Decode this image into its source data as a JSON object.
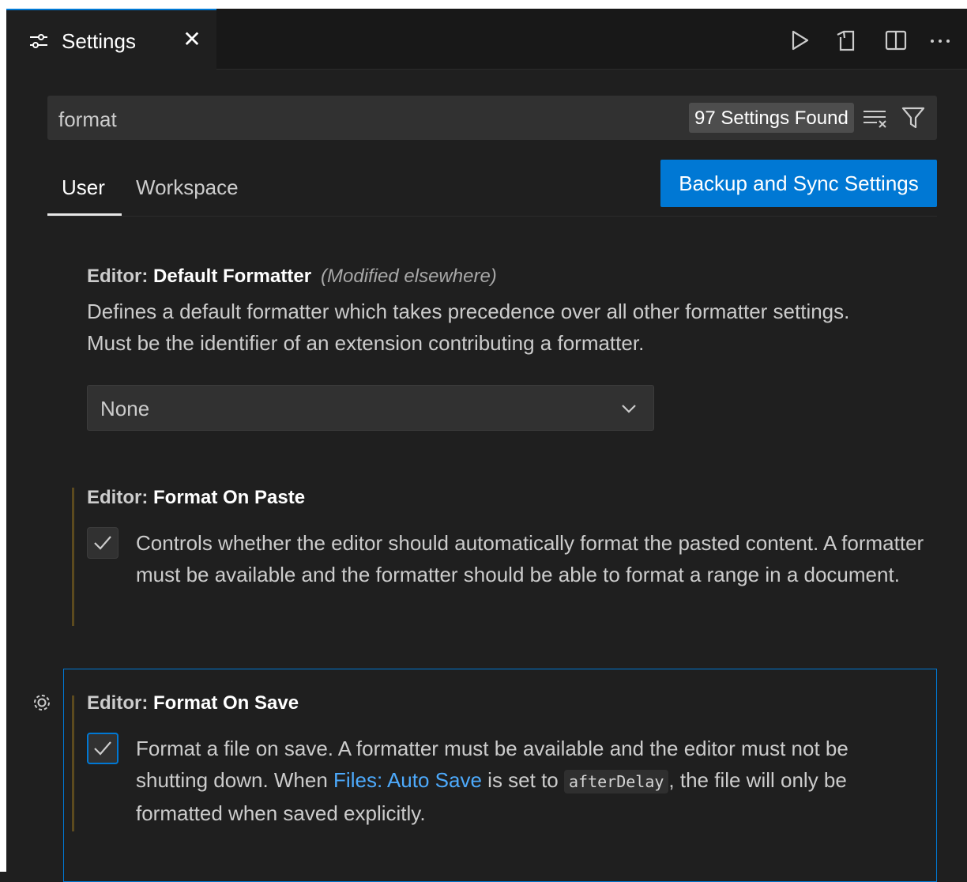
{
  "tab": {
    "label": "Settings"
  },
  "search": {
    "value": "format",
    "results_count": "97 Settings Found"
  },
  "scopes": {
    "user": "User",
    "workspace": "Workspace"
  },
  "sync_button": "Backup and Sync Settings",
  "settings": [
    {
      "category": "Editor: ",
      "name": "Default Formatter",
      "modified": "(Modified elsewhere)",
      "description": "Defines a default formatter which takes precedence over all other formatter settings. Must be the identifier of an extension contributing a formatter.",
      "value": "None"
    },
    {
      "category": "Editor: ",
      "name": "Format On Paste",
      "checked": true,
      "description": "Controls whether the editor should automatically format the pasted content. A formatter must be available and the formatter should be able to format a range in a document."
    },
    {
      "category": "Editor: ",
      "name": "Format On Save",
      "checked": true,
      "desc_before": "Format a file on save. A formatter must be available and the editor must not be shutting down. When ",
      "link": "Files: Auto Save",
      "desc_middle": " is set to ",
      "code": "afterDelay",
      "desc_after": ", the file will only be formatted when saved explicitly."
    }
  ],
  "colors": {
    "accent": "#0078d4",
    "link": "#4daafc",
    "background": "#1f1f1f"
  }
}
